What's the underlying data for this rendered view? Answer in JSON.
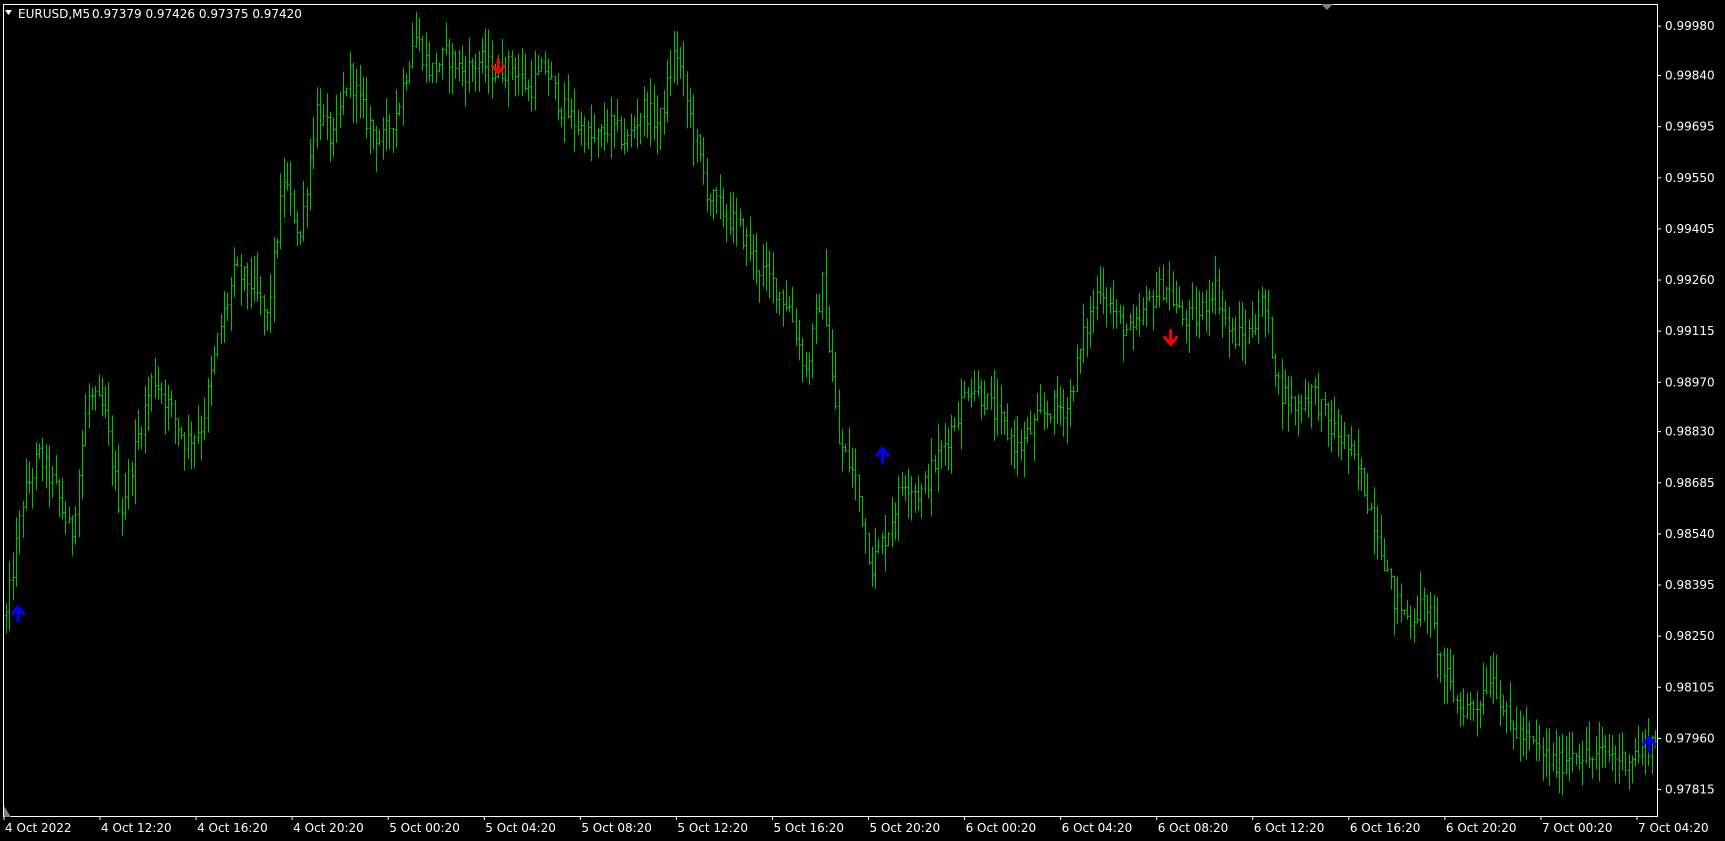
{
  "header": {
    "symbol": "EURUSD,M5",
    "ohlc": "0.97379 0.97426 0.97375 0.97420"
  },
  "colors": {
    "background": "#000000",
    "bars": "#00c000",
    "frame": "#ffffff",
    "buy_arrow": "#0000ff",
    "sell_arrow": "#ff0000"
  },
  "icons": {
    "menu": "triangle-down-icon",
    "buy": "arrow-up-icon",
    "sell": "arrow-down-icon"
  },
  "chart_data": {
    "type": "ohlc-bar",
    "title": "EURUSD,M5",
    "ylim": [
      0.9774,
      1.0004
    ],
    "yticks": [
      "0.99980",
      "0.99840",
      "0.99695",
      "0.99550",
      "0.99405",
      "0.99260",
      "0.99115",
      "0.98970",
      "0.98830",
      "0.98685",
      "0.98540",
      "0.98395",
      "0.98250",
      "0.98105",
      "0.97960",
      "0.97815"
    ],
    "xticks": [
      "4 Oct 2022",
      "4 Oct 12:20",
      "4 Oct 16:20",
      "4 Oct 20:20",
      "5 Oct 00:20",
      "5 Oct 04:20",
      "5 Oct 08:20",
      "5 Oct 12:20",
      "5 Oct 16:20",
      "5 Oct 20:20",
      "6 Oct 00:20",
      "6 Oct 04:20",
      "6 Oct 08:20",
      "6 Oct 12:20",
      "6 Oct 16:20",
      "6 Oct 20:20",
      "7 Oct 00:20",
      "7 Oct 04:20"
    ],
    "grid": false,
    "series": [
      {
        "values": [
          0.98308,
          0.98633,
          0.98763,
          0.9867,
          0.9853,
          0.9893,
          0.9889,
          0.986,
          0.988,
          0.9899,
          0.989,
          0.988,
          0.9885,
          0.991,
          0.9928,
          0.9925,
          0.9915,
          0.9955,
          0.9938,
          0.9975,
          0.9965,
          0.9985,
          0.9972,
          0.9965,
          0.9975,
          0.9996,
          0.9985,
          0.999,
          0.9985,
          0.9988,
          0.9985,
          0.9987,
          0.998,
          0.9986,
          0.9975,
          0.997,
          0.9965,
          0.997,
          0.9965,
          0.9975,
          0.997,
          0.9992,
          0.997,
          0.995,
          0.9945,
          0.994,
          0.993,
          0.9925,
          0.9918,
          0.99,
          0.9925,
          0.988,
          0.987,
          0.9845,
          0.9855,
          0.987,
          0.9865,
          0.9875,
          0.9885,
          0.9897,
          0.9892,
          0.9885,
          0.9878,
          0.9885,
          0.989,
          0.989,
          0.991,
          0.9925,
          0.9915,
          0.991,
          0.992,
          0.9925,
          0.9915,
          0.9915,
          0.9925,
          0.991,
          0.991,
          0.992,
          0.9895,
          0.989,
          0.9895,
          0.9885,
          0.988,
          0.987,
          0.9855,
          0.9835,
          0.983,
          0.9835,
          0.9815,
          0.9805,
          0.9805,
          0.9815,
          0.98,
          0.9796,
          0.9792,
          0.9788,
          0.9793,
          0.979,
          0.9792,
          0.979,
          0.9792,
          0.9796
        ]
      }
    ],
    "signals": [
      {
        "type": "buy",
        "time": "4 Oct 2022",
        "price": 0.9831
      },
      {
        "type": "sell",
        "time": "5 Oct 04:20",
        "price": 0.9987
      },
      {
        "type": "buy",
        "time": "5 Oct 20:20",
        "price": 0.9876
      },
      {
        "type": "sell",
        "time": "6 Oct 08:20",
        "price": 0.991
      },
      {
        "type": "buy",
        "time": "7 Oct 04:20",
        "price": 0.9794
      }
    ]
  }
}
